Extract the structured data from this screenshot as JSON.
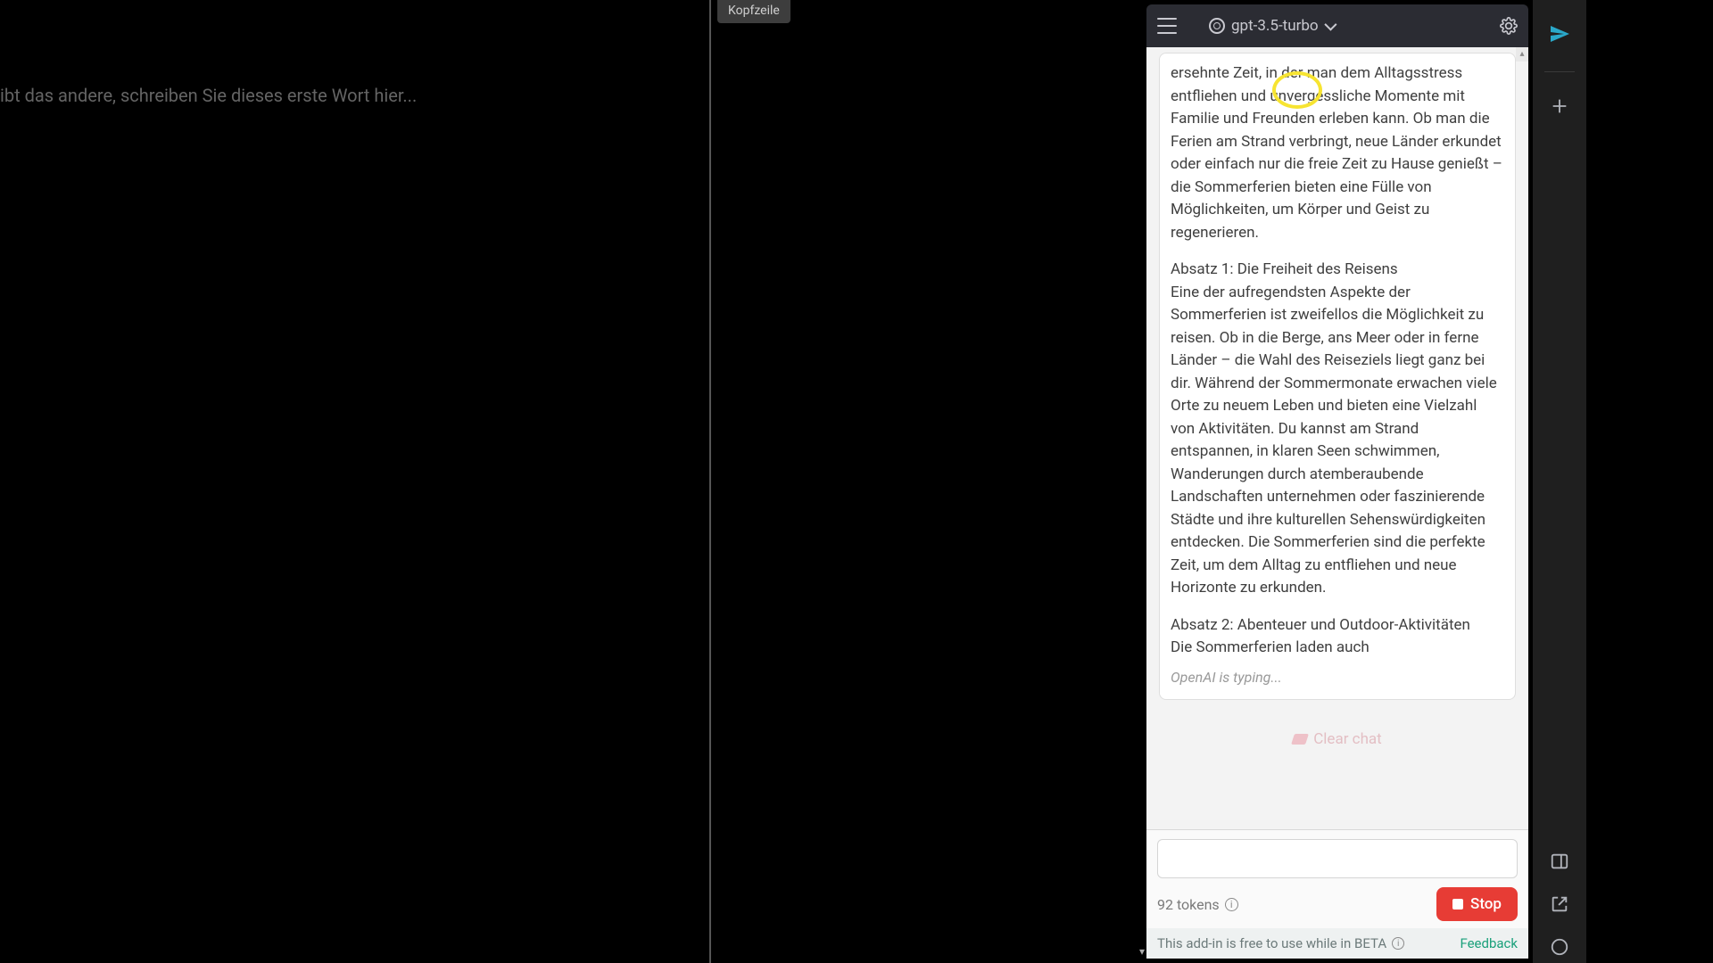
{
  "doc": {
    "tab_label": "Kopfzeile",
    "placeholder": "ibt das andere, schreiben Sie dieses erste Wort hier..."
  },
  "panel": {
    "model": "gpt-3.5-turbo",
    "message": {
      "p1": "ersehnte Zeit, in der man dem Alltagsstress entfliehen und unvergessliche Momente mit Familie und Freunden erleben kann. Ob man die Ferien am Strand verbringt, neue Länder erkundet oder einfach nur die freie Zeit zu Hause genießt – die Sommerferien bieten eine Fülle von Möglichkeiten, um Körper und Geist zu regenerieren.",
      "p2": "Absatz 1: Die Freiheit des Reisens\nEine der aufregendsten Aspekte der Sommerferien ist zweifellos die Möglichkeit zu reisen. Ob in die Berge, ans Meer oder in ferne Länder – die Wahl des Reiseziels liegt ganz bei dir. Während der Sommermonate erwachen viele Orte zu neuem Leben und bieten eine Vielzahl von Aktivitäten. Du kannst am Strand entspannen, in klaren Seen schwimmen, Wanderungen durch atemberaubende Landschaften unternehmen oder faszinierende Städte und ihre kulturellen Sehenswürdigkeiten entdecken. Die Sommerferien sind die perfekte Zeit, um dem Alltag zu entfliehen und neue Horizonte zu erkunden.",
      "p3": "Absatz 2: Abenteuer und Outdoor-Aktivitäten\nDie Sommerferien laden auch",
      "typing": "OpenAI is typing..."
    },
    "clear_label": "Clear chat",
    "input_placeholder": "",
    "tokens_label": "92 tokens",
    "stop_label": "Stop",
    "beta_label": "This add-in is free to use while in BETA",
    "feedback_label": "Feedback"
  }
}
